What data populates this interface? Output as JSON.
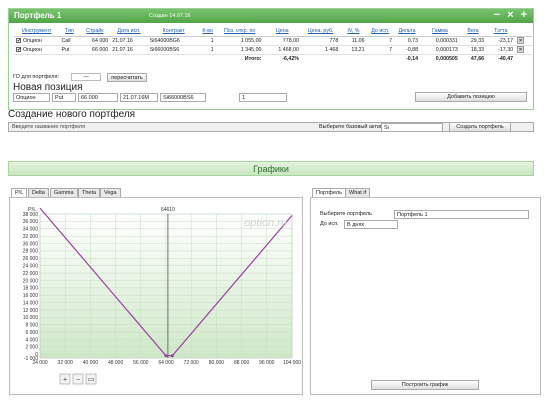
{
  "portfolio": {
    "title": "Портфель 1",
    "created": "Создан 14.07.16",
    "controls": "− × +",
    "headers": [
      "Инструмент",
      "Тип",
      "Страйк",
      "Дата исп.",
      "Контракт",
      "К-во",
      "Поз. откр. по",
      "Цена",
      "Цена, руб.",
      "IV, %",
      "До исп.",
      "Дельта",
      "Гамма",
      "Вега",
      "Тэтта"
    ],
    "rows": [
      {
        "checked": "✔",
        "instrument": "Опцион",
        "type": "Call",
        "strike": "64 000",
        "date": "21.07.16",
        "contract": "Si64000BG6",
        "qty": "1",
        "open": "1 055,00",
        "price": "778,00",
        "price_rub": "778",
        "iv": "11,06",
        "days": "7",
        "delta": "0,73",
        "gamma": "0,000331",
        "vega": "29,33",
        "theta": "-23,17"
      },
      {
        "checked": "✔",
        "instrument": "Опцион",
        "type": "Put",
        "strike": "66 000",
        "date": "21.07.16",
        "contract": "Si66000BS6",
        "qty": "1",
        "open": "1 345,00",
        "price": "1 468,00",
        "price_rub": "1 468",
        "iv": "13,21",
        "days": "7",
        "delta": "-0,88",
        "gamma": "0,000173",
        "vega": "18,33",
        "theta": "-17,30"
      }
    ],
    "total_label": "Итого:",
    "total_pct": "-6,42%",
    "total_delta": "-0,14",
    "total_gamma": "0,000505",
    "total_vega": "47,66",
    "total_theta": "-40,47",
    "go_label": "ГО для портфеля:",
    "go_value": "—",
    "recalc_label": "пересчитать"
  },
  "new_position": {
    "title": "Новая позиция",
    "instrument": "Опцион",
    "type": "Put",
    "strike": "66 000",
    "date": "21.07.16M",
    "contract": "Si66000BS6",
    "qty": "1",
    "add_label": "Добавить позицию"
  },
  "new_portfolio": {
    "title": "Создание нового портфеля",
    "name_placeholder": "Введите название портфеля",
    "asset_label": "Выберите базовый актив",
    "asset_value": "Si",
    "create_label": "Создать портфель"
  },
  "graphs": {
    "title": "Графики",
    "tabs": [
      "P/L",
      "Delta",
      "Gamma",
      "Theta",
      "Vega"
    ],
    "right_tabs": [
      "Портфель",
      "What if"
    ],
    "portfolio_label": "Выберите портфель",
    "portfolio_value": "Портфель 1",
    "exp_label": "До исп.",
    "exp_value": "В днях",
    "build_label": "Построить график",
    "watermark": "option.ru"
  },
  "chart_data": {
    "type": "line",
    "ylabel": "P/L",
    "marker_label": "64610",
    "marker_x": 64610,
    "xlim": [
      24000,
      104000
    ],
    "ylim": [
      -1000,
      38000
    ],
    "x_ticks": [
      "24 000",
      "32 000",
      "40 000",
      "48 000",
      "56 000",
      "64 000",
      "72 000",
      "80 000",
      "88 000",
      "96 000",
      "104 000"
    ],
    "y_ticks": [
      "38 000",
      "36 000",
      "34 000",
      "32 000",
      "30 000",
      "28 000",
      "26 000",
      "24 000",
      "22 000",
      "20 000",
      "18 000",
      "16 000",
      "14 000",
      "12 000",
      "10 000",
      "8 000",
      "6 000",
      "4 000",
      "2 000",
      "0",
      "-1 000"
    ],
    "series": [
      {
        "x": [
          24000,
          64000,
          66000,
          104000
        ],
        "y": [
          39600,
          -400,
          -400,
          37600
        ]
      }
    ],
    "grid": true
  }
}
